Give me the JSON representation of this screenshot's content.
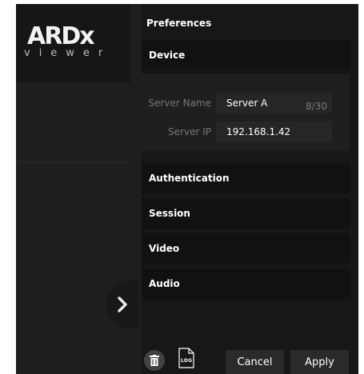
{
  "logo": {
    "main": "ARDx",
    "sub": "viewer"
  },
  "preferences": {
    "title": "Preferences"
  },
  "sections": {
    "device": "Device",
    "authentication": "Authentication",
    "session": "Session",
    "video": "Video",
    "audio": "Audio"
  },
  "device": {
    "server_name_label": "Server Name",
    "server_name_value": "Server A",
    "server_name_count": "8/30",
    "server_ip_label": "Server IP",
    "server_ip_value": "192.168.1.42"
  },
  "footer": {
    "log_label": "LOG",
    "cancel_label": "Cancel",
    "apply_label": "Apply"
  },
  "icons": {
    "nav": "chevron-right-icon",
    "delete": "trash-icon",
    "log": "log-file-icon"
  },
  "colors": {
    "background": "#171717",
    "section_header": "#111111",
    "input_bg": "#262626",
    "button_bg": "#2a2a2a"
  }
}
